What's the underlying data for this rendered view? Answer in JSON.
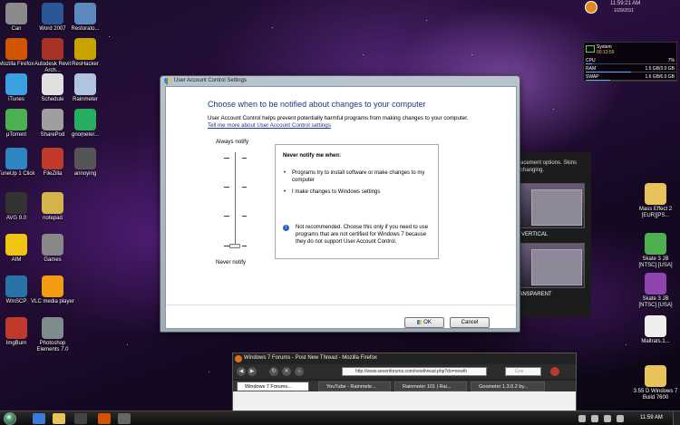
{
  "desktop": {
    "icons_left": [
      {
        "label": "Can",
        "icon": "trash-can-icon",
        "color": "#8a8a8a"
      },
      {
        "label": "Word 2007",
        "icon": "word-icon",
        "color": "#2b5797"
      },
      {
        "label": "Restorato...",
        "icon": "restoration-icon",
        "color": "#5a8abf"
      },
      {
        "label": "Mozilla Firefox",
        "icon": "firefox-icon",
        "color": "#d35400"
      },
      {
        "label": "Autodesk Revit Arch...",
        "icon": "revit-icon",
        "color": "#a93226"
      },
      {
        "label": "ResHacker",
        "icon": "reshacker-icon",
        "color": "#c8a200"
      },
      {
        "label": "iTunes",
        "icon": "itunes-icon",
        "color": "#3aa0e0"
      },
      {
        "label": "Schedule",
        "icon": "calendar-icon",
        "color": "#e0e0e0"
      },
      {
        "label": "Rainmeter",
        "icon": "rainmeter-icon",
        "color": "#b0c4de"
      },
      {
        "label": "µTorrent",
        "icon": "utorrent-icon",
        "color": "#4caf50"
      },
      {
        "label": "SharePod",
        "icon": "sharepod-icon",
        "color": "#9e9e9e"
      },
      {
        "label": "gnometer...",
        "icon": "gnometer-icon",
        "color": "#27ae60"
      },
      {
        "label": "TuneUp 1 Click",
        "icon": "tuneup-icon",
        "color": "#2e86c1"
      },
      {
        "label": "FileZilla",
        "icon": "filezilla-icon",
        "color": "#c0392b"
      },
      {
        "label": "annoying",
        "icon": "camera-icon",
        "color": "#555555"
      },
      {
        "label": "AVG 9.0",
        "icon": "avg-icon",
        "color": "#333333"
      },
      {
        "label": "notepad",
        "icon": "notepad-icon",
        "color": "#d4b44a"
      },
      {
        "label": "AIM",
        "icon": "aim-icon",
        "color": "#f1c40f"
      },
      {
        "label": "Games",
        "icon": "games-icon",
        "color": "#888888"
      },
      {
        "label": "WinSCP",
        "icon": "winscp-icon",
        "color": "#2874a6"
      },
      {
        "label": "VLC media player",
        "icon": "vlc-icon",
        "color": "#f39c12"
      },
      {
        "label": "ImgBurn",
        "icon": "imgburn-icon",
        "color": "#c0392b"
      },
      {
        "label": "Photoshop Elements 7.0",
        "icon": "photoshop-icon",
        "color": "#7f8c8d"
      }
    ],
    "icons_right": [
      {
        "label": "Mass Effect 2 [EUR][PS...",
        "icon": "folder-icon",
        "color": "#e8c25a"
      },
      {
        "label": "Skate 3 JB [NTSC] [USA]",
        "icon": "utorrent-file-icon",
        "color": "#4caf50"
      },
      {
        "label": "Skate 3 JB [NTSC] [USA]",
        "icon": "winrar-icon",
        "color": "#8e44ad"
      },
      {
        "label": "Maltrats.1...",
        "icon": "video-file-icon",
        "color": "#eeeeee"
      },
      {
        "label": "3.55 D Windows 7 Build 7600",
        "icon": "folder-icon",
        "color": "#e8c25a"
      }
    ]
  },
  "clock_gadget": {
    "time": "11:59:21 AM",
    "date": "1/29/2011"
  },
  "system_gadget": {
    "title": "System",
    "uptime": "00:13:59",
    "rows": [
      {
        "label": "CPU",
        "value": "7%",
        "fill": 0.07
      },
      {
        "label": "RAM",
        "value": "1.5 GB/3.0 GB",
        "fill": 0.5
      },
      {
        "label": "SWAP",
        "value": "1.6 GB/6.0 GB",
        "fill": 0.27
      }
    ]
  },
  "bg_window": {
    "text": "...acement options. Skins ...changing.",
    "thumb1_label": "VERTICAL",
    "thumb2_label": "...RANSPARENT"
  },
  "uac": {
    "title": "User Account Control Settings",
    "heading": "Choose when to be notified about changes to your computer",
    "description": "User Account Control helps prevent potentially harmful programs from making changes to your computer.",
    "link": "Tell me more about User Account Control settings",
    "slider_top_label": "Always notify",
    "slider_bottom_label": "Never notify",
    "slider_level_of_4": 1,
    "info_title": "Never notify me when:",
    "bullets": [
      "Programs try to install software or make changes to my computer",
      "I make changes to Windows settings"
    ],
    "note": "Not recommended. Choose this only if you need to use programs that are not certified for Windows 7 because they do not support User Account Control.",
    "ok_label": "OK",
    "cancel_label": "Cancel"
  },
  "firefox": {
    "title": "Windows 7 Forums - Post New Thread - Mozilla Firefox",
    "url": "http://www.sevenforums.com/newthread.php?do=newth",
    "search_placeholder": "Goo",
    "tabs": [
      {
        "label": "Windows 7 Forums...",
        "active": true
      },
      {
        "label": "YouTube - Rainmete...",
        "active": false
      },
      {
        "label": "Rainmeter 101 | Rai...",
        "active": false
      },
      {
        "label": "Gnometer 1.3.0.2 by...",
        "active": false
      }
    ]
  },
  "taskbar": {
    "time": "11:59 AM"
  }
}
